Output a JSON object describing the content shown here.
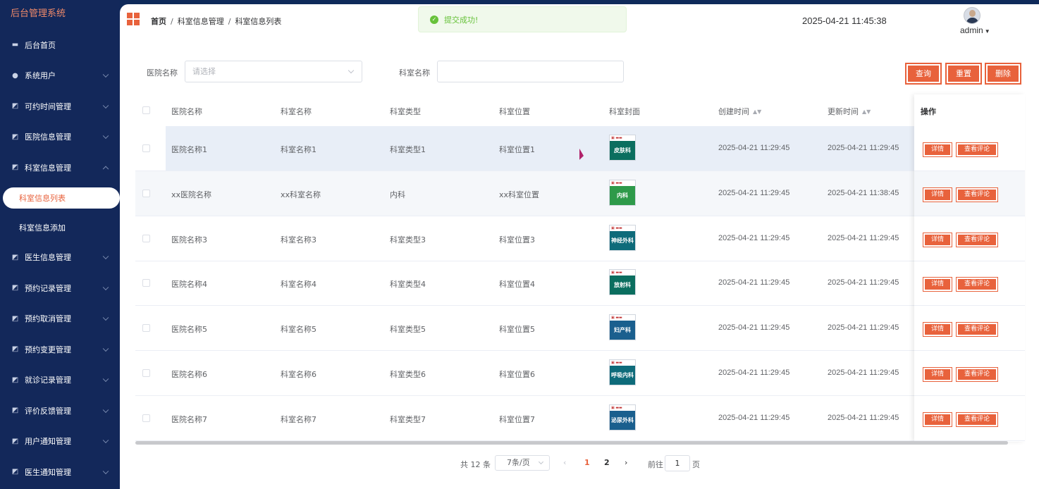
{
  "app": {
    "title": "后台管理系统"
  },
  "sidebar": {
    "items": [
      {
        "label": "后台首页",
        "icon": "monitor-icon",
        "expandable": false
      },
      {
        "label": "系统用户",
        "icon": "user-icon",
        "expandable": true
      },
      {
        "label": "可约时间管理",
        "icon": "chart-icon",
        "expandable": true
      },
      {
        "label": "医院信息管理",
        "icon": "chart-icon",
        "expandable": true
      },
      {
        "label": "科室信息管理",
        "icon": "chart-icon",
        "expandable": true,
        "expanded": true
      }
    ],
    "submenu": [
      {
        "label": "科室信息列表",
        "active": true
      },
      {
        "label": "科室信息添加",
        "active": false
      }
    ],
    "items_after": [
      {
        "label": "医生信息管理"
      },
      {
        "label": "预约记录管理"
      },
      {
        "label": "预约取消管理"
      },
      {
        "label": "预约变更管理"
      },
      {
        "label": "就诊记录管理"
      },
      {
        "label": "评价反馈管理"
      },
      {
        "label": "用户通知管理"
      },
      {
        "label": "医生通知管理"
      }
    ]
  },
  "header": {
    "breadcrumb": [
      "首页",
      "科室信息管理",
      "科室信息列表"
    ],
    "toast": "提交成功!",
    "datetime": "2025-04-21 11:45:38",
    "username": "admin",
    "accent": "#e8623c"
  },
  "filters": {
    "hospital_label": "医院名称",
    "hospital_placeholder": "请选择",
    "dept_label": "科室名称",
    "dept_value": "",
    "query_label": "查询",
    "reset_label": "重置",
    "delete_label": "删除"
  },
  "table": {
    "columns": [
      "医院名称",
      "科室名称",
      "科室类型",
      "科室位置",
      "科室封面",
      "创建时间",
      "更新时间",
      "操作"
    ],
    "rows": [
      {
        "hospital": "医院名称1",
        "dept": "科室名称1",
        "type": "科室类型1",
        "location": "科室位置1",
        "cover": "皮肤科",
        "cover_color": "#0b6e5f",
        "created": "2025-04-21 11:29:45",
        "updated": "2025-04-21 11:29:45"
      },
      {
        "hospital": "xx医院名称",
        "dept": "xx科室名称",
        "type": "内科",
        "location": "xx科室位置",
        "cover": "内科",
        "cover_color": "#2e9a4a",
        "created": "2025-04-21 11:29:45",
        "updated": "2025-04-21 11:38:45"
      },
      {
        "hospital": "医院名称3",
        "dept": "科室名称3",
        "type": "科室类型3",
        "location": "科室位置3",
        "cover": "神经外科",
        "cover_color": "#0e6b7a",
        "created": "2025-04-21 11:29:45",
        "updated": "2025-04-21 11:29:45"
      },
      {
        "hospital": "医院名称4",
        "dept": "科室名称4",
        "type": "科室类型4",
        "location": "科室位置4",
        "cover": "放射科",
        "cover_color": "#0b6e5f",
        "created": "2025-04-21 11:29:45",
        "updated": "2025-04-21 11:29:45"
      },
      {
        "hospital": "医院名称5",
        "dept": "科室名称5",
        "type": "科室类型5",
        "location": "科室位置5",
        "cover": "妇产科",
        "cover_color": "#1a5f8e",
        "created": "2025-04-21 11:29:45",
        "updated": "2025-04-21 11:29:45"
      },
      {
        "hospital": "医院名称6",
        "dept": "科室名称6",
        "type": "科室类型6",
        "location": "科室位置6",
        "cover": "呼吸内科",
        "cover_color": "#0e6b7a",
        "created": "2025-04-21 11:29:45",
        "updated": "2025-04-21 11:29:45"
      },
      {
        "hospital": "医院名称7",
        "dept": "科室名称7",
        "type": "科室类型7",
        "location": "科室位置7",
        "cover": "泌尿外科",
        "cover_color": "#1a5f8e",
        "created": "2025-04-21 11:29:45",
        "updated": "2025-04-21 11:29:45"
      }
    ],
    "action_detail": "详情",
    "action_comments": "查看评论"
  },
  "pagination": {
    "total_text": "共 12 条",
    "page_size": "7条/页",
    "pages": [
      "1",
      "2"
    ],
    "current": "1",
    "goto_label": "前往",
    "goto_value": "1",
    "goto_unit": "页"
  }
}
